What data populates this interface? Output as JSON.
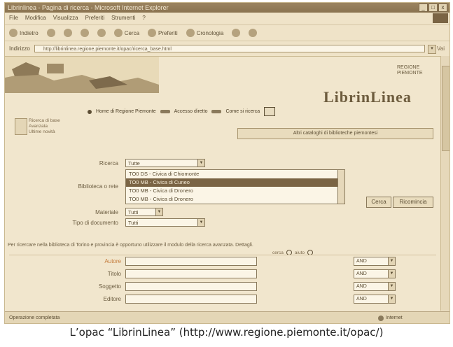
{
  "window": {
    "title": "Librinlinea - Pagina di ricerca - Microsoft Internet Explorer",
    "controls": [
      "_",
      "□",
      "x"
    ]
  },
  "menu": [
    "File",
    "Modifica",
    "Visualizza",
    "Preferiti",
    "Strumenti",
    "?"
  ],
  "toolbar": {
    "back": "Indietro",
    "search": "Cerca",
    "favorites": "Preferiti",
    "history": "Cronologia"
  },
  "address": {
    "label": "Indirizzo",
    "url": "http://librinlinea.regione.piemonte.it/opac/ricerca_base.html",
    "go": "Vai"
  },
  "page": {
    "logo": "LibrinLinea",
    "corner_text": [
      "REGIONE",
      "PIEMONTE"
    ],
    "nav_links": [
      "Home di Regione Piemonte",
      "Accesso diretto",
      "Come si ricerca"
    ],
    "side_text": [
      "Ricerca di base",
      "Avanzata",
      "Ultime novità"
    ],
    "wide_button": "Altri cataloghi di biblioteche piemontesi",
    "form": {
      "field1_label": "Ricerca",
      "field1_value": "Tutte",
      "list_label": "Biblioteca o rete",
      "list_options": [
        "TO0 DS - Civica di Chiomonte",
        "TO0 MB - Civica di Cuneo",
        "TO0 MB - Civica di Dronero",
        "TO0 MB - Civica di Dronero"
      ],
      "list_selected_index": 1,
      "field2_label": "Materiale",
      "field2_value": "Tutti",
      "field3_label": "Tipo di documento",
      "field3_value": "Tutti",
      "search_button": "Cerca",
      "reset_button": "Ricomincia"
    },
    "hint": "Per ricercare nella biblioteca di Torino e provincia è opportuno utilizzare il modulo della ricerca avanzata. Dettagli.",
    "hint2": [
      "cerca",
      "aiuto"
    ],
    "search_rows": [
      {
        "label": "Autore",
        "op": "AND"
      },
      {
        "label": "Titolo",
        "op": "AND"
      },
      {
        "label": "Soggetto",
        "op": "AND"
      },
      {
        "label": "Editore",
        "op": "AND"
      }
    ]
  },
  "status": {
    "left": "Operazione completata",
    "right": "Internet"
  },
  "caption": "L’opac “LibrinLinea” (http://www.regione.piemonte.it/opac/)"
}
